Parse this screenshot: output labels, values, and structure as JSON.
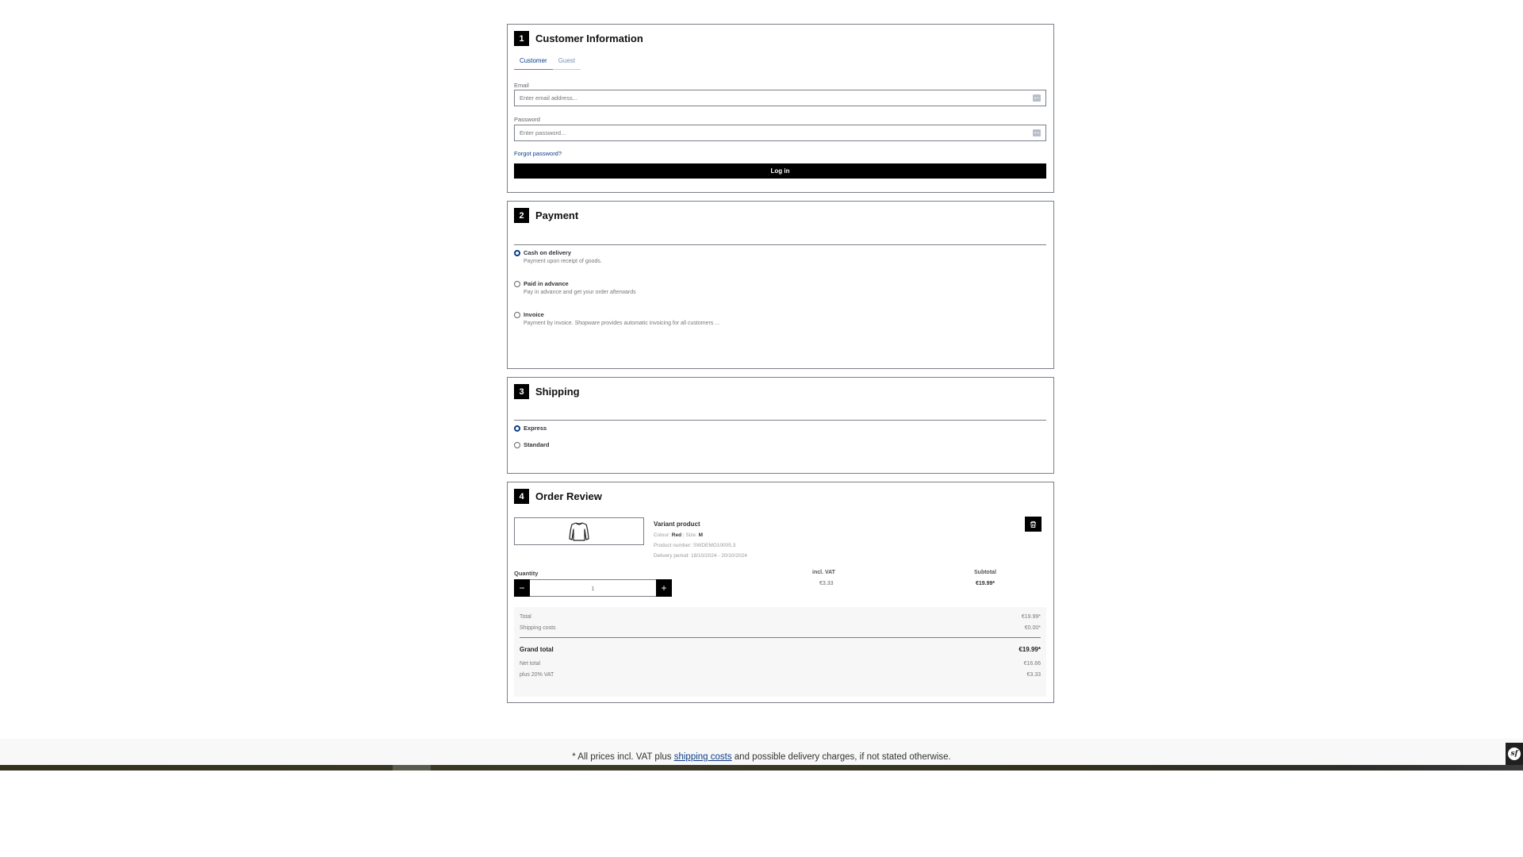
{
  "customer_information": {
    "number": "1",
    "title": "Customer Information",
    "tabs": [
      {
        "label": "Customer",
        "active": true
      },
      {
        "label": "Guest",
        "active": false
      }
    ],
    "email": {
      "label": "Email",
      "placeholder": "Enter email address...",
      "value": ""
    },
    "password": {
      "label": "Password",
      "placeholder": "Enter password...",
      "value": ""
    },
    "forgot_password": "Forgot password?",
    "login_button": "Log in"
  },
  "payment": {
    "number": "2",
    "title": "Payment",
    "options": [
      {
        "label": "Cash on delivery",
        "description": "Payment upon receipt of goods.",
        "selected": true
      },
      {
        "label": "Paid in advance",
        "description": "Pay in advance and get your order afterwards",
        "selected": false
      },
      {
        "label": "Invoice",
        "description": "Payment by invoice. Shopware provides automatic invoicing for all customers ...",
        "selected": false
      }
    ]
  },
  "shipping": {
    "number": "3",
    "title": "Shipping",
    "options": [
      {
        "label": "Express",
        "selected": true
      },
      {
        "label": "Standard",
        "selected": false
      }
    ]
  },
  "order_review": {
    "number": "4",
    "title": "Order Review",
    "product": {
      "image_icon": "longsleeve-shirt-icon",
      "name": "Variant product",
      "colour_label": "Colour:",
      "colour_value": "Red",
      "size_label": "Size:",
      "size_value": "M",
      "product_number": "Product number: SWDEMO10005.3",
      "delivery_period": "Delivery period: 18/10/2024 - 20/10/2024"
    },
    "remove_icon": "trash-icon",
    "quantity_label": "Quantity",
    "quantity_value": "1",
    "quantity_minus": "−",
    "quantity_plus": "+",
    "incl_vat_label": "incl. VAT",
    "incl_vat_value": "€3.33",
    "subtotal_label": "Subtotal",
    "subtotal_value": "€19.99*",
    "summary": {
      "total_label": "Total",
      "total_value": "€19.99*",
      "shipping_label": "Shipping costs",
      "shipping_value": "€0.00*",
      "grand_total_label": "Grand total",
      "grand_total_value": "€19.99*",
      "net_total_label": "Net total",
      "net_total_value": "€16.66",
      "vat_label": "plus 20% VAT",
      "vat_value": "€3.33"
    }
  },
  "footer": {
    "note_prefix": "* All prices incl. VAT plus ",
    "note_link": "shipping costs",
    "note_suffix": " and possible delivery charges, if not stated otherwise."
  },
  "debug_toolbar": {
    "logo_text": "sf"
  },
  "colors": {
    "accent_blue": "#0b3c8a",
    "tab_underline": "#e2573f",
    "button_black": "#000000",
    "border_gray": "#7a7f87"
  }
}
